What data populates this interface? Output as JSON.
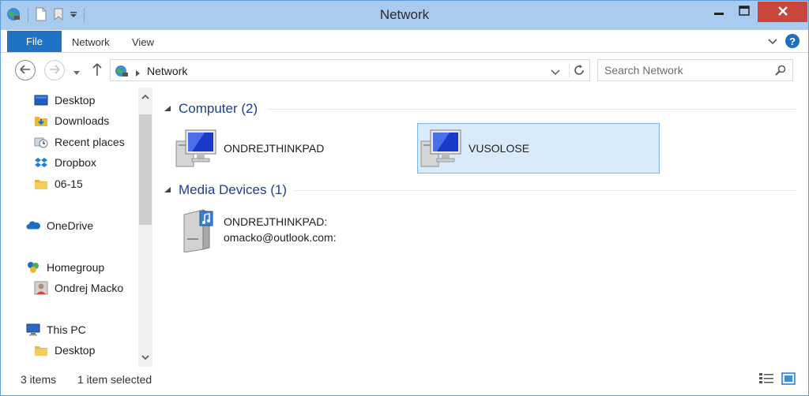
{
  "window": {
    "title": "Network"
  },
  "ribbon": {
    "file_label": "File",
    "tabs": [
      "Network",
      "View"
    ],
    "help_label": "?"
  },
  "address": {
    "crumb": "Network"
  },
  "search": {
    "placeholder": "Search Network"
  },
  "navpane": {
    "items": [
      {
        "label": "Desktop",
        "icon": "desktop-icon"
      },
      {
        "label": "Downloads",
        "icon": "downloads-folder-icon"
      },
      {
        "label": "Recent places",
        "icon": "recent-places-icon"
      },
      {
        "label": "Dropbox",
        "icon": "dropbox-icon"
      },
      {
        "label": "06-15",
        "icon": "folder-icon"
      },
      {
        "label": "OneDrive",
        "icon": "onedrive-icon"
      },
      {
        "label": "Homegroup",
        "icon": "homegroup-icon"
      },
      {
        "label": "Ondrej Macko",
        "icon": "user-avatar-icon"
      },
      {
        "label": "This PC",
        "icon": "this-pc-icon"
      },
      {
        "label": "Desktop",
        "icon": "desktop-folder-icon"
      }
    ]
  },
  "content": {
    "groups": [
      {
        "title": "Computer (2)",
        "items": [
          {
            "label": "ONDREJTHINKPAD",
            "icon": "network-computer-icon",
            "selected": false
          },
          {
            "label": "VUSOLOSE",
            "icon": "network-computer-icon",
            "selected": true
          }
        ]
      },
      {
        "title": "Media Devices (1)",
        "items": [
          {
            "label_line1": "ONDREJTHINKPAD:",
            "label_line2": "omacko@outlook.com:",
            "icon": "media-server-icon",
            "selected": false
          }
        ]
      }
    ]
  },
  "status": {
    "item_count": "3 items",
    "selected": "1 item selected"
  },
  "colors": {
    "titlebar": "#a9cbef",
    "file_tab": "#1e73c6",
    "close_button": "#c9463d",
    "group_header": "#1e3f8c",
    "selection": "#d9ebfb"
  }
}
